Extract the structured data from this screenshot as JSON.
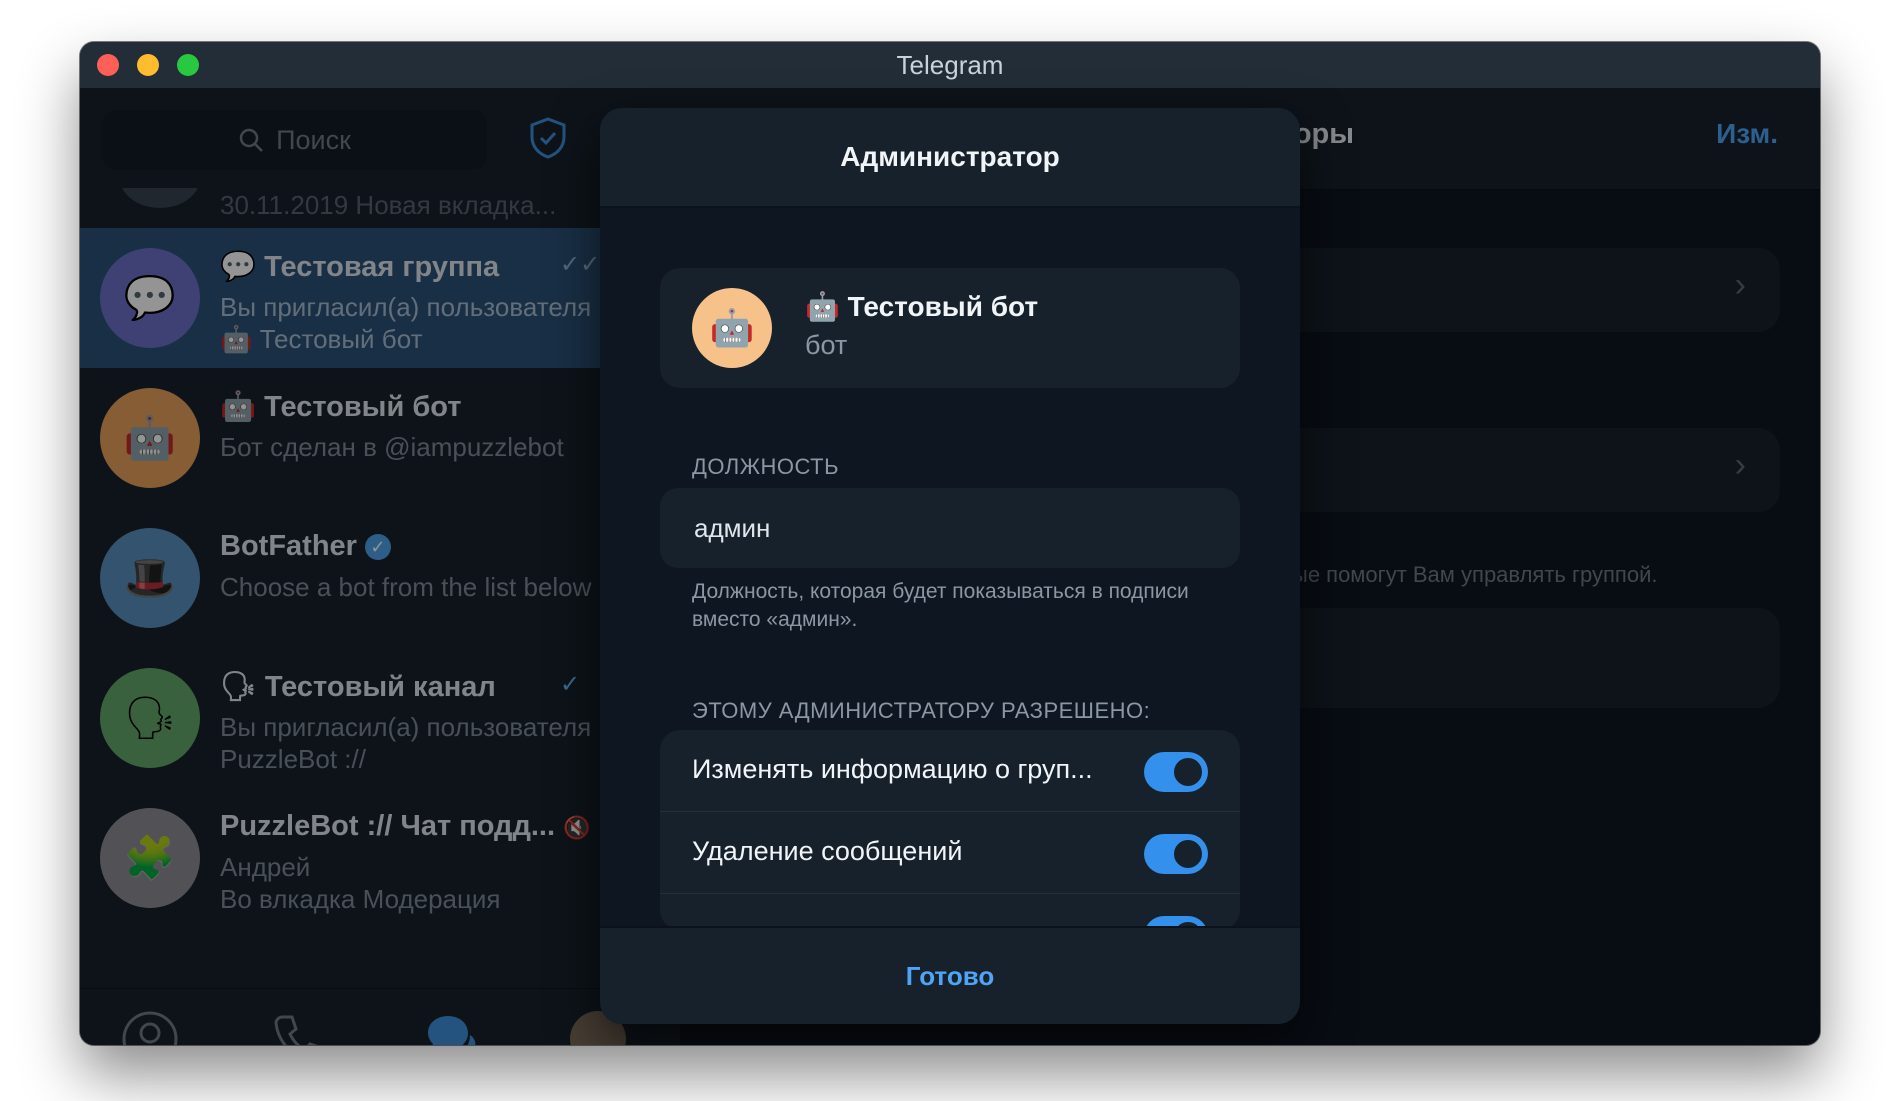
{
  "window": {
    "title": "Telegram"
  },
  "search": {
    "placeholder": "Поиск"
  },
  "chats": {
    "partial_top": "30.11.2019      Новая вкладка...",
    "items": [
      {
        "name": "Тестовая группа",
        "line1": "Вы пригласил(а) пользователя",
        "line2": "🤖 Тестовый бот",
        "status": "✓✓",
        "avatar_emoji": "💬",
        "name_emoji": "💬"
      },
      {
        "name": "Тестовый бот",
        "line1": "Бот сделан в @iampuzzlebot",
        "line2": "",
        "status": "",
        "avatar_emoji": "🤖",
        "name_emoji": "🤖"
      },
      {
        "name": "BotFather",
        "line1": "Choose a bot from the list below",
        "line2": "",
        "status": "",
        "avatar_emoji": "🎩",
        "name_emoji": ""
      },
      {
        "name": "Тестовый канал",
        "line1": "Вы пригласил(а) пользователя",
        "line2": "PuzzleBot ://",
        "status": "✓",
        "avatar_emoji": "🗣",
        "name_emoji": "🗣"
      },
      {
        "name": "PuzzleBot :// Чат подд...",
        "line1": "Андрей",
        "line2": "Во влкадка Модерация",
        "status": "",
        "avatar_emoji": "🧩",
        "name_emoji": ""
      }
    ]
  },
  "right": {
    "title_fragment": "торы",
    "edit_label": "Изм.",
    "hint_fragment": "ые помогут Вам управлять группой."
  },
  "modal": {
    "title": "Администратор",
    "bot": {
      "emoji": "🤖",
      "name": "Тестовый бот",
      "subtitle": "бот"
    },
    "rank_section": "ДОЛЖНОСТЬ",
    "rank_value": "админ",
    "rank_hint": "Должность, которая будет показываться в подписи вместо «админ».",
    "perm_section": "ЭТОМУ АДМИНИСТРАТОРУ РАЗРЕШЕНО:",
    "permissions": [
      {
        "label": "Изменять информацию о груп...",
        "enabled": true
      },
      {
        "label": "Удаление сообщений",
        "enabled": true
      },
      {
        "label": "",
        "enabled": true
      }
    ],
    "done_label": "Готово"
  }
}
